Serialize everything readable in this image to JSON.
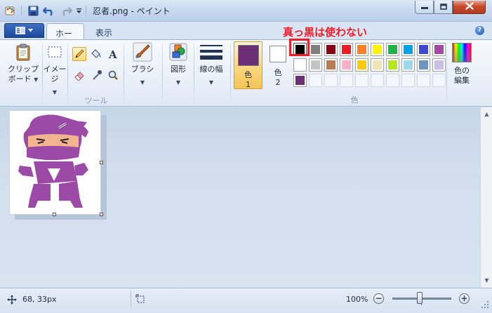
{
  "titlebar": {
    "title": "忍者.png - ペイント",
    "icons": [
      "paint-app-icon",
      "save-icon",
      "undo-icon",
      "redo-icon",
      "customize-qat-icon"
    ]
  },
  "window_buttons": [
    "minimize-icon",
    "maximize-icon",
    "close-icon"
  ],
  "tabs": [
    {
      "label": "ホーム",
      "active": true
    },
    {
      "label": "表示",
      "active": false
    }
  ],
  "ribbon": {
    "clipboard": {
      "label_line1": "クリップ",
      "label_line2": "ボード"
    },
    "image": {
      "label": "イメージ"
    },
    "tools": {
      "group_label": "ツール"
    },
    "brushes": {
      "label": "ブラシ"
    },
    "shapes": {
      "label": "図形"
    },
    "line_width": {
      "label": "線の幅"
    },
    "color1": {
      "label_line1": "色",
      "label_line2": "1",
      "value": "#6b2d73"
    },
    "color2": {
      "label_line1": "色",
      "label_line2": "2",
      "value": "#ffffff"
    },
    "colors_group_label": "色",
    "edit_colors": {
      "label_line1": "色の",
      "label_line2": "編集"
    },
    "palette_row1": [
      "#000000",
      "#7f7f7f",
      "#880015",
      "#ed1c24",
      "#ff7f27",
      "#fff200",
      "#22b14c",
      "#00a2e8",
      "#3f48cc",
      "#a349a4"
    ],
    "palette_row2": [
      "#ffffff",
      "#c3c3c3",
      "#b97a57",
      "#ffaec9",
      "#ffc90e",
      "#efe4b0",
      "#b5e61d",
      "#99d9ea",
      "#7092be",
      "#c8bfe7"
    ],
    "palette_row3_custom": [
      "#6b2d73"
    ]
  },
  "annotation": {
    "text": "真っ黒は使わない",
    "color": "#e8202a"
  },
  "statusbar": {
    "cursor_position": "68, 33px",
    "zoom": "100%",
    "zoom_out_label": "−",
    "zoom_in_label": "+"
  }
}
